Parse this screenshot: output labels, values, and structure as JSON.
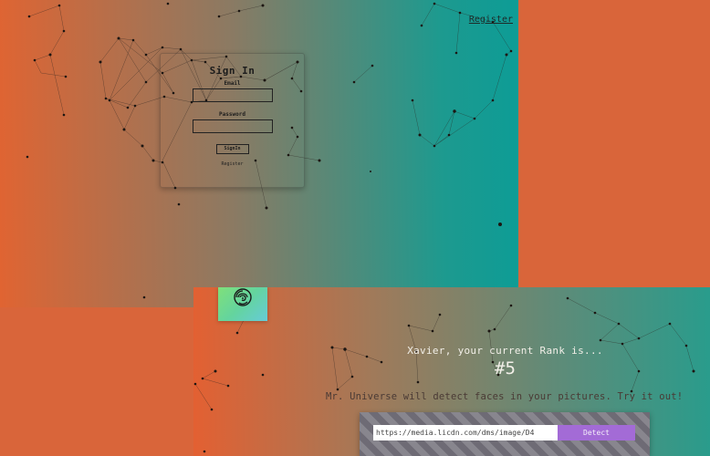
{
  "nav": {
    "register_label": "Register"
  },
  "signin": {
    "title": "Sign In",
    "email_label": "Email",
    "password_label": "Password",
    "signin_button": "SignIn",
    "register_link": "Register"
  },
  "home": {
    "logo_icon": "brain-icon",
    "rank_text": "Xavier, your current Rank is...",
    "rank_number": "#5",
    "description": "Mr. Universe will detect faces in your pictures. Try it out!",
    "url_input_value": "https://media.licdn.com/dms/image/D4",
    "detect_button": "Detect"
  },
  "colors": {
    "page_background": "#d9653a",
    "gradient_left": "#e06432",
    "gradient_right": "#0d9c96",
    "detect_button": "#a36bd6",
    "logo_tile": "#7fe07a"
  }
}
